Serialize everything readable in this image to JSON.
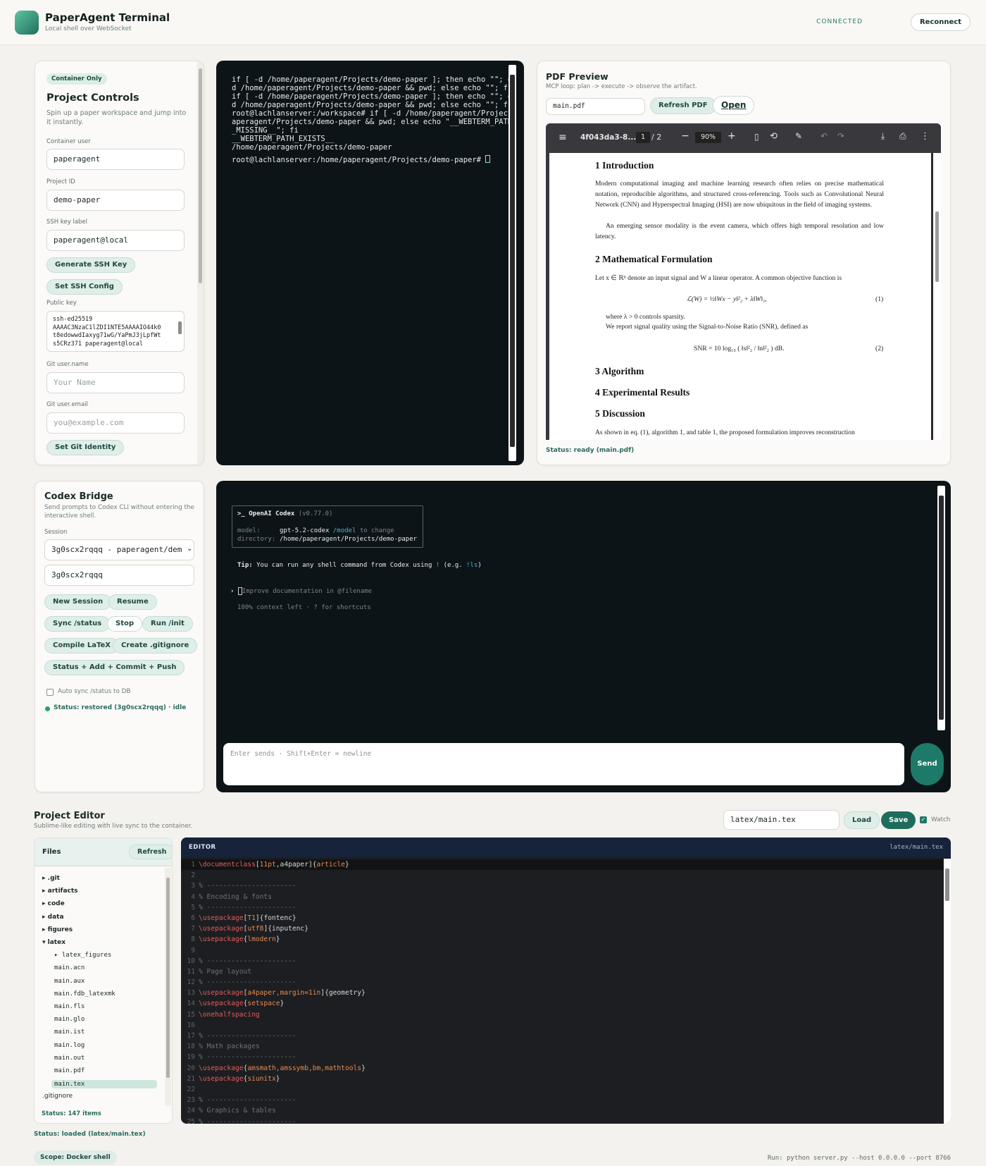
{
  "header": {
    "title": "PaperAgent Terminal",
    "subtitle": "Local shell over WebSocket",
    "connection": "CONNECTED",
    "reconnect": "Reconnect"
  },
  "controls": {
    "badge": "Container Only",
    "title": "Project Controls",
    "desc": "Spin up a paper workspace and jump into it instantly.",
    "container_user_label": "Container user",
    "container_user": "paperagent",
    "project_id_label": "Project ID",
    "project_id": "demo-paper",
    "ssh_label_label": "SSH key label",
    "ssh_label": "paperagent@local",
    "gen_ssh": "Generate SSH Key",
    "set_ssh": "Set SSH Config",
    "public_key_label": "Public key",
    "public_key_lines": [
      "ssh-ed25519",
      "AAAAC3NzaC1lZDI1NTE5AAAAIO44k0",
      "t8edowwdIaxyg71wG/YaPmJ3jLpfWt",
      "s5CRz371 paperagent@local"
    ],
    "git_name_label": "Git user.name",
    "git_name_ph": "Your Name",
    "git_email_label": "Git user.email",
    "git_email_ph": "you@example.com",
    "set_git": "Set Git Identity"
  },
  "terminal": {
    "lines": [
      "if [ -d /home/paperagent/Projects/demo-paper ]; then echo \"\"; e",
      "d /home/paperagent/Projects/demo-paper && pwd; else echo \"\"; f",
      "if [ -d /home/paperagent/Projects/demo-paper ]; then echo \"\"; e",
      "d /home/paperagent/Projects/demo-paper && pwd; else echo \"\"; f",
      "root@lachlanserver:/workspace# if [ -d /home/paperagent/Project",
      "aperagent/Projects/demo-paper && pwd; else echo \"__WEBTERM_PATH",
      "_MISSING__\"; fi",
      "__WEBTERM_PATH_EXISTS__",
      "/home/paperagent/Projects/demo-paper",
      "root@lachlanserver:/home/paperagent/Projects/demo-paper# "
    ]
  },
  "pdf": {
    "title": "PDF Preview",
    "subtitle": "MCP loop: plan -> execute -> observe the artifact.",
    "file": "main.pdf",
    "refresh": "Refresh PDF",
    "open": "Open",
    "doc_id": "4f043da3-8...",
    "page": "1",
    "pages": "/ 2",
    "zoom": "90%",
    "s1": "1   Introduction",
    "p1": "Modern computational imaging and machine learning research often relies on precise mathematical notation, reproducible algorithms, and structured cross-referencing.  Tools such as Convolutional Neural Network (CNN) and Hyperspectral Imaging (HSI) are now ubiquitous in the field of imaging systems.",
    "p2": "An emerging sensor modality is the event camera, which offers high temporal resolution and low latency.",
    "s2": "2   Mathematical Formulation",
    "p3": "Let x ∈ ℝⁿ denote an input signal and W a linear operator.  A common objective function is",
    "eq1": "ℒ(W) = ½‖Wx − y‖²₂ + λ‖W‖₁,",
    "eq1n": "(1)",
    "p4": "where λ > 0 controls sparsity.",
    "p5": "We report signal quality using the Signal-to-Noise Ratio (SNR), defined as",
    "eq2": "SNR = 10 log₁₀ ( ‖s‖²₂ / ‖n‖²₂ ) dB.",
    "eq2n": "(2)",
    "s3": "3   Algorithm",
    "s4": "4   Experimental Results",
    "s5": "5   Discussion",
    "p6": "As shown in eq. (1), algorithm 1, and table 1, the proposed formulation improves reconstruction",
    "status": "Status: ready (main.pdf)"
  },
  "codex": {
    "title": "Codex Bridge",
    "desc": "Send prompts to Codex CLI without entering the interactive shell.",
    "session_label": "Session",
    "session_select": "3g0scx2rqqq - paperagent/dem",
    "session_id": "3g0scx2rqqq",
    "new_session": "New Session",
    "resume": "Resume",
    "sync": "Sync /status",
    "stop": "Stop",
    "run_init": "Run /init",
    "compile": "Compile LaTeX",
    "gitignore": "Create .gitignore",
    "commit": "Status + Add + Commit + Push",
    "auto_sync": "Auto sync /status to DB",
    "status": "Status: restored (3g0scx2rqqq) · idle",
    "box_title": ">_ OpenAI Codex",
    "box_version": "(v0.77.0)",
    "model_key": "model:",
    "model_val": "gpt-5.2-codex",
    "model_hint": "/model",
    "model_hint2": "to change",
    "dir_key": "directory:",
    "dir_val": "/home/paperagent/Projects/demo-paper",
    "tip_b": "Tip:",
    "tip": "You can run any shell command from Codex using",
    "tip_bang": "!",
    "tip2": "(e.g.",
    "tip_ls": "!ls",
    "tip3": ")",
    "prompt_ph": "Improve documentation in @filename",
    "context": "100% context left · ? for shortcuts",
    "input_ph": "Enter sends · Shift+Enter = newline",
    "send": "Send"
  },
  "editor": {
    "title": "Project Editor",
    "desc": "Sublime-like editing with live sync to the container.",
    "path": "latex/main.tex",
    "load": "Load",
    "save": "Save",
    "watch": "Watch",
    "files_title": "Files",
    "files_refresh": "Refresh",
    "tree": [
      {
        "name": "▸ .git",
        "indent": 0,
        "bold": true
      },
      {
        "name": "▸ artifacts",
        "indent": 0,
        "bold": true
      },
      {
        "name": "▸ code",
        "indent": 0,
        "bold": true
      },
      {
        "name": "▸ data",
        "indent": 0,
        "bold": true
      },
      {
        "name": "▸ figures",
        "indent": 0,
        "bold": true
      },
      {
        "name": "▾ latex",
        "indent": 0,
        "bold": true
      },
      {
        "name": "▸ latex_figures",
        "indent": 1,
        "bold": true
      },
      {
        "name": "main.acn",
        "indent": 1
      },
      {
        "name": "main.aux",
        "indent": 1
      },
      {
        "name": "main.fdb_latexmk",
        "indent": 1
      },
      {
        "name": "main.fls",
        "indent": 1
      },
      {
        "name": "main.glo",
        "indent": 1
      },
      {
        "name": "main.ist",
        "indent": 1
      },
      {
        "name": "main.log",
        "indent": 1
      },
      {
        "name": "main.out",
        "indent": 1
      },
      {
        "name": "main.pdf",
        "indent": 1
      },
      {
        "name": "main.tex",
        "indent": 1,
        "selected": true
      },
      {
        "name": ".gitignore",
        "indent": 0
      }
    ],
    "files_status": "Status: 147 items",
    "pane_label": "EDITOR",
    "pane_path": "latex/main.tex",
    "status": "Status: loaded (latex/main.tex)",
    "scope": "Scope: Docker shell",
    "run_cmd": "Run: python server.py --host 0.0.0.0 --port 8766",
    "code": [
      [
        [
          "kw",
          "\\documentclass"
        ],
        [
          "",
          "["
        ],
        [
          "ar",
          "11pt"
        ],
        [
          "",
          ",a4paper]{"
        ],
        [
          "ar",
          "article"
        ],
        [
          "",
          "}"
        ]
      ],
      [],
      [
        [
          "cm",
          "% ----------------------"
        ]
      ],
      [
        [
          "cm",
          "% Encoding & fonts"
        ]
      ],
      [
        [
          "cm",
          "% ----------------------"
        ]
      ],
      [
        [
          "kw",
          "\\usepackage"
        ],
        [
          "",
          "["
        ],
        [
          "ar",
          "T1"
        ],
        [
          "",
          "]{fontenc}"
        ]
      ],
      [
        [
          "kw",
          "\\usepackage"
        ],
        [
          "",
          "["
        ],
        [
          "ar",
          "utf8"
        ],
        [
          "",
          "]{inputenc}"
        ]
      ],
      [
        [
          "kw",
          "\\usepackage"
        ],
        [
          "",
          "{"
        ],
        [
          "ar",
          "lmodern"
        ],
        [
          "",
          "}"
        ]
      ],
      [],
      [
        [
          "cm",
          "% ----------------------"
        ]
      ],
      [
        [
          "cm",
          "% Page layout"
        ]
      ],
      [
        [
          "cm",
          "% ----------------------"
        ]
      ],
      [
        [
          "kw",
          "\\usepackage"
        ],
        [
          "",
          "["
        ],
        [
          "ar",
          "a4paper,margin=1in"
        ],
        [
          "",
          "]{geometry}"
        ]
      ],
      [
        [
          "kw",
          "\\usepackage"
        ],
        [
          "",
          "{"
        ],
        [
          "ar",
          "setspace"
        ],
        [
          "",
          "}"
        ]
      ],
      [
        [
          "kw",
          "\\onehalfspacing"
        ]
      ],
      [],
      [
        [
          "cm",
          "% ----------------------"
        ]
      ],
      [
        [
          "cm",
          "% Math packages"
        ]
      ],
      [
        [
          "cm",
          "% ----------------------"
        ]
      ],
      [
        [
          "kw",
          "\\usepackage"
        ],
        [
          "",
          "{"
        ],
        [
          "ar",
          "amsmath,amssymb,bm,mathtools"
        ],
        [
          "",
          "}"
        ]
      ],
      [
        [
          "kw",
          "\\usepackage"
        ],
        [
          "",
          "{"
        ],
        [
          "ar",
          "siunitx"
        ],
        [
          "",
          "}"
        ]
      ],
      [],
      [
        [
          "cm",
          "% ----------------------"
        ]
      ],
      [
        [
          "cm",
          "% Graphics & tables"
        ]
      ],
      [
        [
          "cm",
          "% ----------------------"
        ]
      ]
    ]
  }
}
